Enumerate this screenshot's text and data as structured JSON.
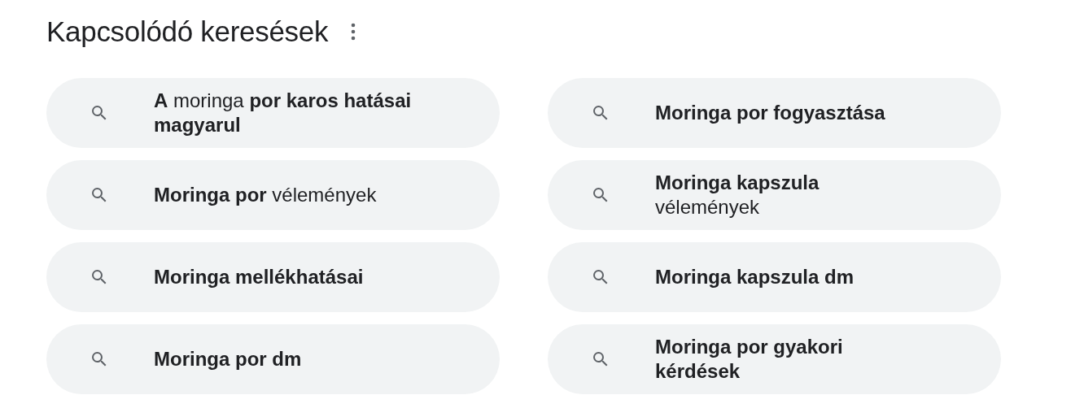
{
  "title": "Kapcsolódó keresések",
  "suggestions": [
    {
      "text": "**A** moringa **por karos hatásai magyarul**"
    },
    {
      "text": "**Moringa por** vélemények"
    },
    {
      "text": "Moringa mellékhatásai"
    },
    {
      "text": "Moringa por dm"
    },
    {
      "text": "Moringa por fogyasztása"
    },
    {
      "text": "**Moringa kapszula** vélemények"
    },
    {
      "text": "Moringa kapszula dm"
    },
    {
      "text": "Moringa por gyakori kérdések"
    }
  ]
}
